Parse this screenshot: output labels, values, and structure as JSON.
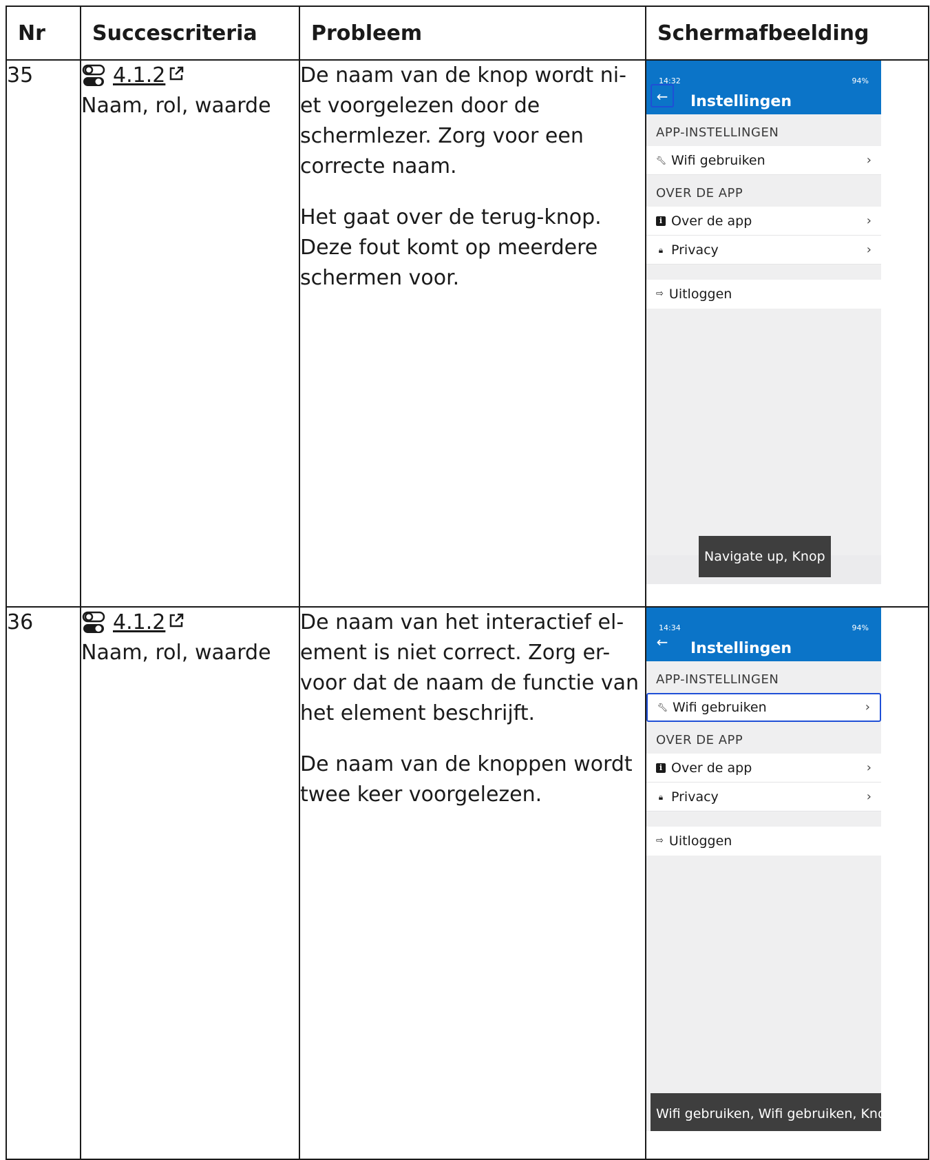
{
  "headers": {
    "nr": "Nr",
    "criterion": "Succescriteria",
    "problem": "Probleem",
    "screenshot": "Schermafbeelding"
  },
  "rows": [
    {
      "nr": "35",
      "criterion_code": "4.1.2",
      "criterion_name": "Naam, rol, waarde",
      "problem": [
        "De naam van de knop wordt ni- et voorgelezen door de schermlezer. Zorg voor een correcte naam.",
        "Het gaat over de terug-knop. Deze fout komt op meerdere schermen voor."
      ],
      "phone": {
        "status_time": "14:32",
        "status_right": "94%",
        "title": "Instellingen",
        "section1": "APP-INSTELLINGEN",
        "item_wifi": "Wifi gebruiken",
        "section2": "OVER DE APP",
        "item_about": "Over de app",
        "item_privacy": "Privacy",
        "item_logout": "Uitloggen",
        "talkback": "Navigate up, Knop"
      }
    },
    {
      "nr": "36",
      "criterion_code": "4.1.2",
      "criterion_name": "Naam, rol, waarde",
      "problem": [
        "De naam van het interactief el- ement is niet correct. Zorg er- voor dat de naam de functie van het element beschrijft.",
        "De naam van de knoppen wordt twee keer voorgelezen."
      ],
      "phone": {
        "status_time": "14:34",
        "status_right": "94%",
        "title": "Instellingen",
        "section1": "APP-INSTELLINGEN",
        "item_wifi": "Wifi gebruiken",
        "section2": "OVER DE APP",
        "item_about": "Over de app",
        "item_privacy": "Privacy",
        "item_logout": "Uitloggen",
        "talkback": "Wifi gebruiken, Wifi gebruiken, Knop"
      }
    }
  ],
  "colors": {
    "app_bar": "#0b74c8",
    "focus_outline": "#1f4fd6",
    "talkback_bg": "#3e3e3e"
  }
}
